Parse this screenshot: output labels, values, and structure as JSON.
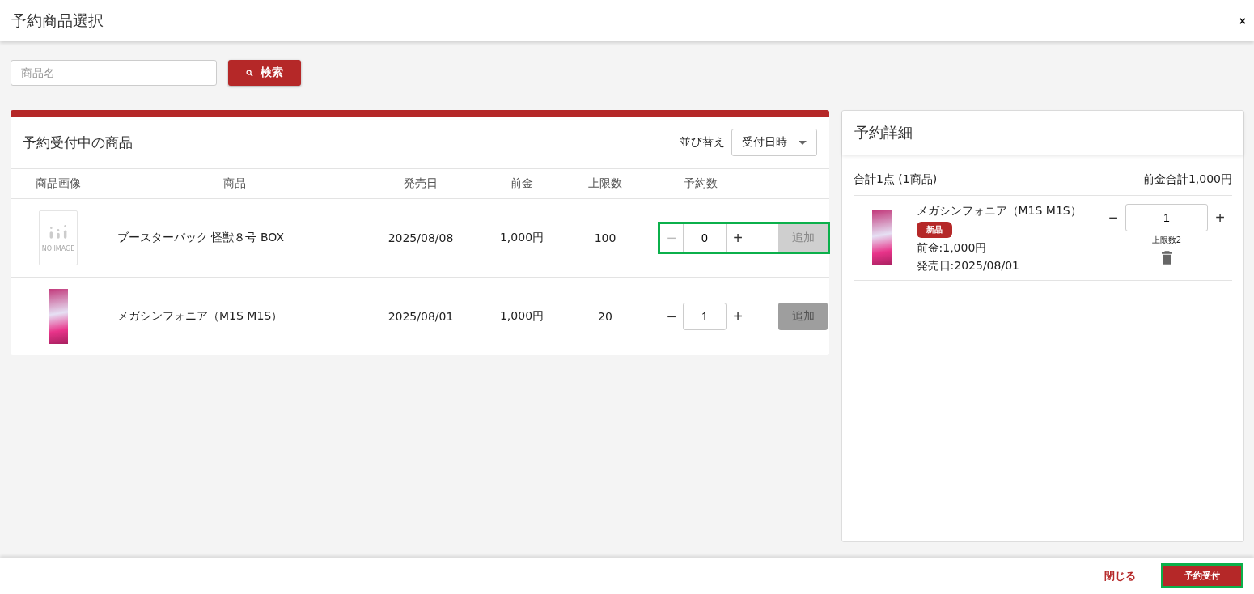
{
  "window": {
    "title": "予約商品選択",
    "close": "×"
  },
  "search": {
    "placeholder": "商品名",
    "button": "検索"
  },
  "products": {
    "title": "予約受付中の商品",
    "sort_label": "並び替え",
    "sort_value": "受付日時",
    "columns": [
      "商品画像",
      "商品",
      "発売日",
      "前金",
      "上限数",
      "予約数"
    ],
    "rows": [
      {
        "image": {
          "kind": "no-image",
          "caption": "NO IMAGE"
        },
        "name": "ブースターパック 怪獣８号 BOX",
        "release": "2025/08/08",
        "deposit": "1,000円",
        "limit": "100",
        "quantity": "0",
        "minus": "−",
        "plus": "+",
        "minus_disabled": true,
        "add": "追加",
        "add_disabled": true,
        "highlighted": true
      },
      {
        "image": {
          "kind": "pack"
        },
        "name": "メガシンフォニア（M1S M1S）",
        "release": "2025/08/01",
        "deposit": "1,000円",
        "limit": "20",
        "quantity": "1",
        "minus": "−",
        "plus": "+",
        "minus_disabled": false,
        "add": "追加",
        "add_disabled": false,
        "highlighted": false
      }
    ]
  },
  "details": {
    "title": "予約詳細",
    "summary": "合計1点 (1商品)",
    "total": "前金合計1,000円",
    "items": [
      {
        "image": {
          "kind": "pack"
        },
        "name": "メガシンフォニア（M1S M1S）",
        "badge": "新品",
        "deposit": "前金:1,000円",
        "release": "発売日:2025/08/01",
        "minus": "−",
        "quantity": "1",
        "plus": "+",
        "limit": "上限数2"
      }
    ]
  },
  "footer": {
    "close": "閉じる",
    "submit": "予約受付",
    "submit_highlighted": true
  }
}
